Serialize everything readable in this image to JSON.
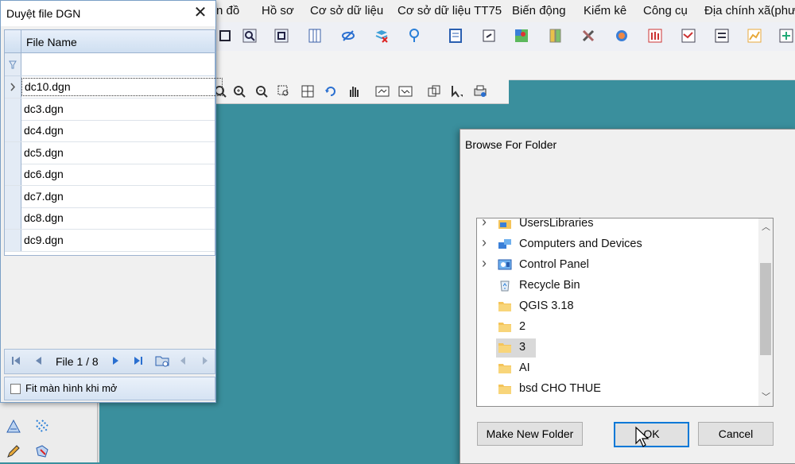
{
  "menubar": {
    "items": [
      "n đồ",
      "Hồ sơ",
      "Cơ sở dữ liệu",
      "Cơ sở dữ liệu TT75",
      "Biến động",
      "Kiểm kê",
      "Công cụ",
      "Địa chính xã(phư"
    ]
  },
  "dgn_window": {
    "title": "Duyệt file DGN",
    "column_header": "File Name",
    "files": [
      "dc10.dgn",
      "dc3.dgn",
      "dc4.dgn",
      "dc5.dgn",
      "dc6.dgn",
      "dc7.dgn",
      "dc8.dgn",
      "dc9.dgn"
    ],
    "active_index": 0,
    "pager_label": "File 1 / 8",
    "fit_checkbox_label": "Fit màn hình khi mở",
    "fit_checked": false
  },
  "browse_dialog": {
    "title": "Browse For Folder",
    "tree": [
      {
        "label": "UsersLibraries",
        "icon": "libraries-icon",
        "expandable": true
      },
      {
        "label": "Computers and Devices",
        "icon": "network-icon",
        "expandable": true
      },
      {
        "label": "Control Panel",
        "icon": "control-panel-icon",
        "expandable": true
      },
      {
        "label": "Recycle Bin",
        "icon": "recycle-bin-icon",
        "expandable": false
      },
      {
        "label": "QGIS 3.18",
        "icon": "folder-icon",
        "expandable": false
      },
      {
        "label": "2",
        "icon": "folder-icon",
        "expandable": false
      },
      {
        "label": "3",
        "icon": "folder-icon",
        "expandable": false,
        "selected": true
      },
      {
        "label": "AI",
        "icon": "folder-icon",
        "expandable": false
      },
      {
        "label": "bsd CHO THUE",
        "icon": "folder-icon",
        "expandable": false
      }
    ],
    "make_folder_label": "Make New Folder",
    "ok_label": "OK",
    "cancel_label": "Cancel"
  },
  "colors": {
    "canvas": "#3a8f9d",
    "folder": "#f4c45a",
    "accent": "#0078d7"
  }
}
